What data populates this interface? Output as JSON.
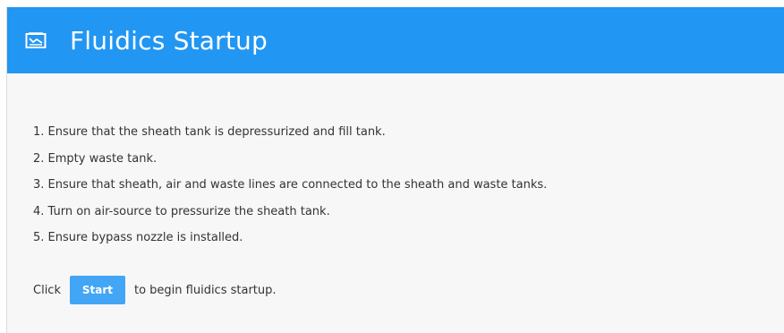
{
  "header": {
    "title": "Fluidics Startup",
    "icon": "fluidics-panel-icon",
    "background_color": "#2196f3"
  },
  "steps": [
    "1. Ensure that the sheath tank is depressurized and fill tank.",
    "2. Empty waste tank.",
    "3. Ensure that sheath, air and waste lines are connected to the sheath and waste tanks.",
    "4. Turn on air-source to pressurize the sheath tank.",
    "5. Ensure bypass nozzle is installed."
  ],
  "start_prompt": {
    "prefix": "Click",
    "button_label": "Start",
    "suffix": "to begin fluidics startup.",
    "button_color": "#42a5f5"
  }
}
